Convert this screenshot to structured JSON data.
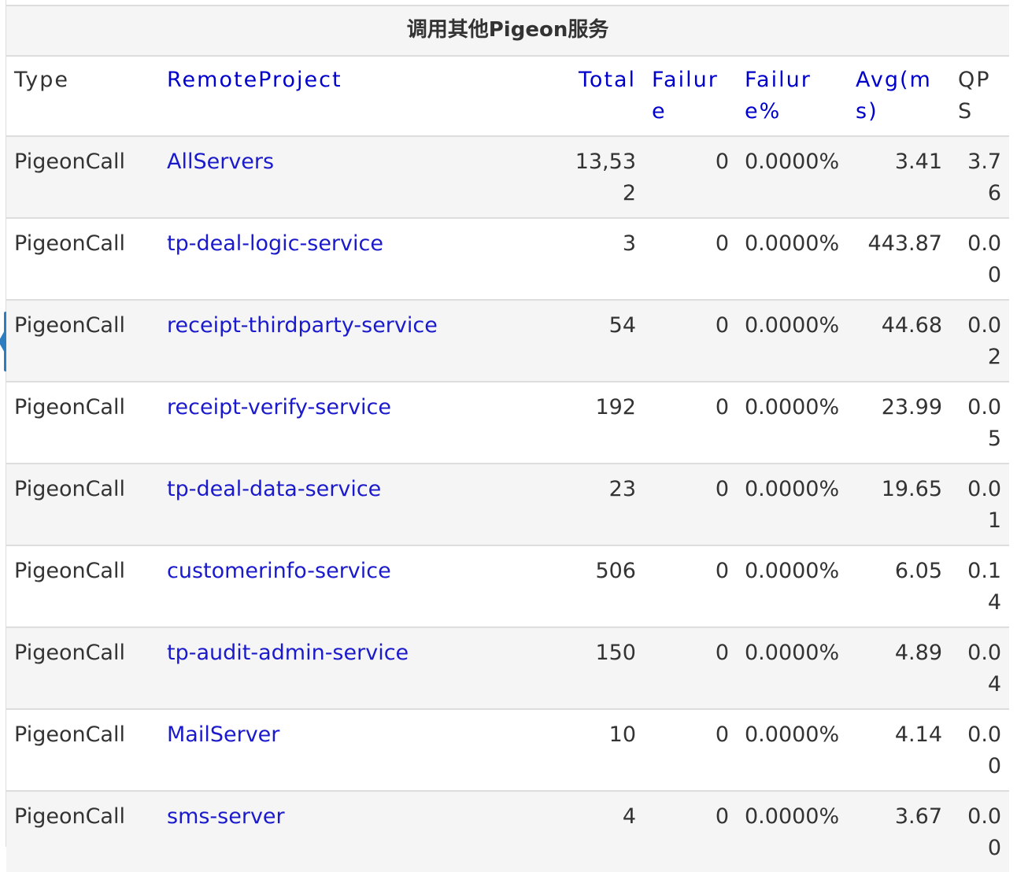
{
  "table": {
    "title": "调用其他Pigeon服务",
    "headers": {
      "type": "Type",
      "remote_project": "RemoteProject",
      "total": "Total",
      "failure": "Failure",
      "failure_pct": "Failure%",
      "avg": "Avg(ms)",
      "qps": "QPS"
    },
    "rows": [
      {
        "type": "PigeonCall",
        "project": "AllServers",
        "total": "13,532",
        "failure": "0",
        "failure_pct": "0.0000%",
        "avg": "3.41",
        "qps": "3.76"
      },
      {
        "type": "PigeonCall",
        "project": "tp-deal-logic-service",
        "total": "3",
        "failure": "0",
        "failure_pct": "0.0000%",
        "avg": "443.87",
        "qps": "0.00"
      },
      {
        "type": "PigeonCall",
        "project": "receipt-thirdparty-service",
        "total": "54",
        "failure": "0",
        "failure_pct": "0.0000%",
        "avg": "44.68",
        "qps": "0.02"
      },
      {
        "type": "PigeonCall",
        "project": "receipt-verify-service",
        "total": "192",
        "failure": "0",
        "failure_pct": "0.0000%",
        "avg": "23.99",
        "qps": "0.05"
      },
      {
        "type": "PigeonCall",
        "project": "tp-deal-data-service",
        "total": "23",
        "failure": "0",
        "failure_pct": "0.0000%",
        "avg": "19.65",
        "qps": "0.01"
      },
      {
        "type": "PigeonCall",
        "project": "customerinfo-service",
        "total": "506",
        "failure": "0",
        "failure_pct": "0.0000%",
        "avg": "6.05",
        "qps": "0.14"
      },
      {
        "type": "PigeonCall",
        "project": "tp-audit-admin-service",
        "total": "150",
        "failure": "0",
        "failure_pct": "0.0000%",
        "avg": "4.89",
        "qps": "0.04"
      },
      {
        "type": "PigeonCall",
        "project": "MailServer",
        "total": "10",
        "failure": "0",
        "failure_pct": "0.0000%",
        "avg": "4.14",
        "qps": "0.00"
      },
      {
        "type": "PigeonCall",
        "project": "sms-server",
        "total": "4",
        "failure": "0",
        "failure_pct": "0.0000%",
        "avg": "3.67",
        "qps": "0.00"
      }
    ]
  },
  "colors": {
    "link": "#0000cc",
    "row_alt": "#f5f5f5",
    "border": "#dddddd",
    "side_tab": "#2f7dc1"
  },
  "side_tab": {
    "icon": "chevron-left-icon"
  }
}
